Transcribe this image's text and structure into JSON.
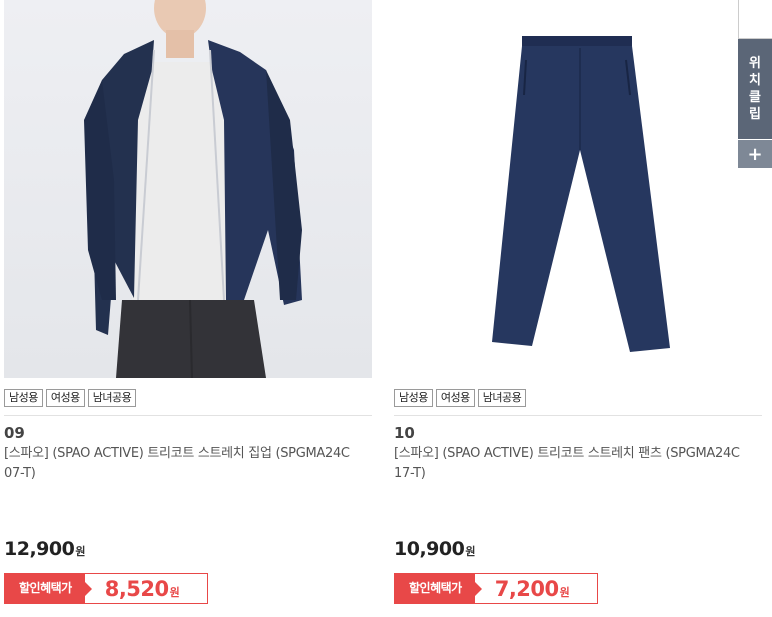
{
  "products": [
    {
      "tags": [
        "남성용",
        "여성용",
        "남녀공용"
      ],
      "number": "09",
      "name": "[스파오] (SPAO ACTIVE) 트리코트 스트레치 집업 (SPGMA24C07-T)",
      "price": "12,900",
      "price_unit": "원",
      "discount_label": "할인혜택가",
      "discount_price": "8,520",
      "discount_unit": "원",
      "image_icon": "navy-zip-jacket-model-photo"
    },
    {
      "tags": [
        "남성용",
        "여성용",
        "남녀공용"
      ],
      "number": "10",
      "name": "[스파오] (SPAO ACTIVE) 트리코트 스트레치 팬츠 (SPGMA24C17-T)",
      "price": "10,900",
      "price_unit": "원",
      "discount_label": "할인혜택가",
      "discount_price": "7,200",
      "discount_unit": "원",
      "image_icon": "navy-pants-photo"
    }
  ],
  "sidebar": {
    "clip_chars": [
      "위",
      "치",
      "클",
      "립"
    ],
    "plus_icon": "plus-icon"
  },
  "colors": {
    "accent": "#e84848",
    "sidebar": "#5b6677",
    "navy": "#233556"
  }
}
